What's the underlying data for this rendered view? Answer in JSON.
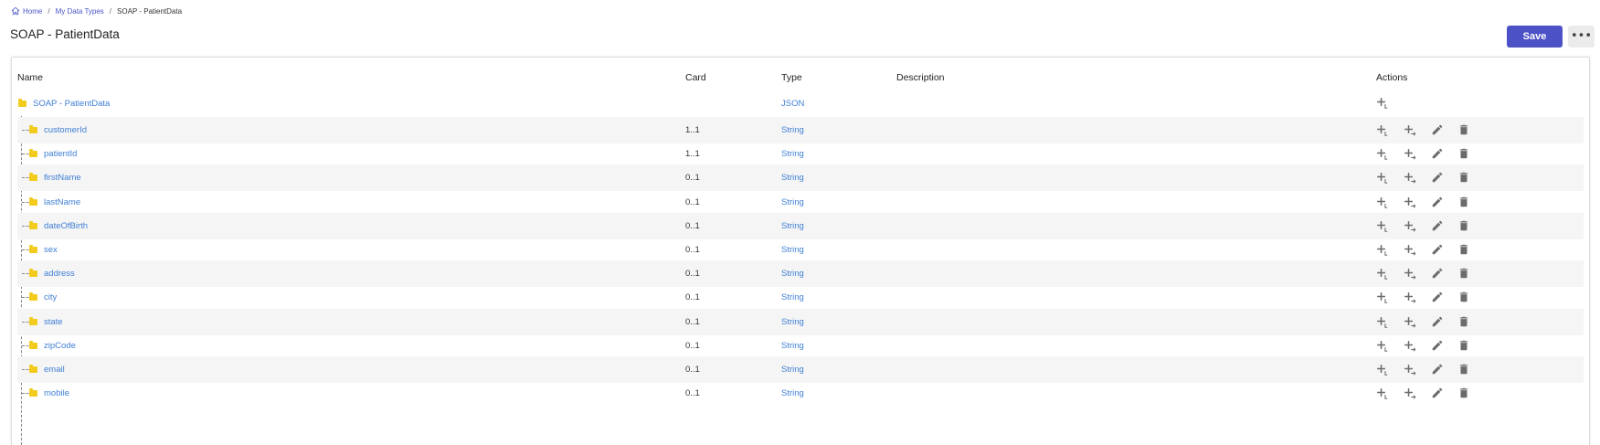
{
  "breadcrumb": {
    "home": "Home",
    "my_data_types": "My Data Types",
    "current": "SOAP - PatientData"
  },
  "page": {
    "title": "SOAP - PatientData",
    "save_label": "Save",
    "more_label": "•••"
  },
  "table": {
    "columns": {
      "name": "Name",
      "card": "Card",
      "type": "Type",
      "description": "Description",
      "actions": "Actions"
    },
    "root": {
      "name": "SOAP - PatientData",
      "card": "",
      "type": "JSON",
      "description": ""
    },
    "rows": [
      {
        "name": "customerId",
        "card": "1..1",
        "type": "String",
        "description": ""
      },
      {
        "name": "patientId",
        "card": "1..1",
        "type": "String",
        "description": ""
      },
      {
        "name": "firstName",
        "card": "0..1",
        "type": "String",
        "description": ""
      },
      {
        "name": "lastName",
        "card": "0..1",
        "type": "String",
        "description": ""
      },
      {
        "name": "dateOfBirth",
        "card": "0..1",
        "type": "String",
        "description": ""
      },
      {
        "name": "sex",
        "card": "0..1",
        "type": "String",
        "description": ""
      },
      {
        "name": "address",
        "card": "0..1",
        "type": "String",
        "description": ""
      },
      {
        "name": "city",
        "card": "0..1",
        "type": "String",
        "description": ""
      },
      {
        "name": "state",
        "card": "0..1",
        "type": "String",
        "description": ""
      },
      {
        "name": "zipCode",
        "card": "0..1",
        "type": "String",
        "description": ""
      },
      {
        "name": "email",
        "card": "0..1",
        "type": "String",
        "description": ""
      },
      {
        "name": "mobile",
        "card": "0..1",
        "type": "String",
        "description": ""
      }
    ]
  },
  "icons": {
    "home": "home-icon",
    "folder": "folder-icon",
    "add_child": "add-child-icon",
    "add_sibling": "add-sibling-icon",
    "edit": "pencil-icon",
    "delete": "trash-icon"
  },
  "colors": {
    "accent": "#4c51c6",
    "link": "#3f7fd4",
    "folder": "#f2cb1d",
    "stripe": "#f5f5f5",
    "icon": "#6b6b6b"
  }
}
